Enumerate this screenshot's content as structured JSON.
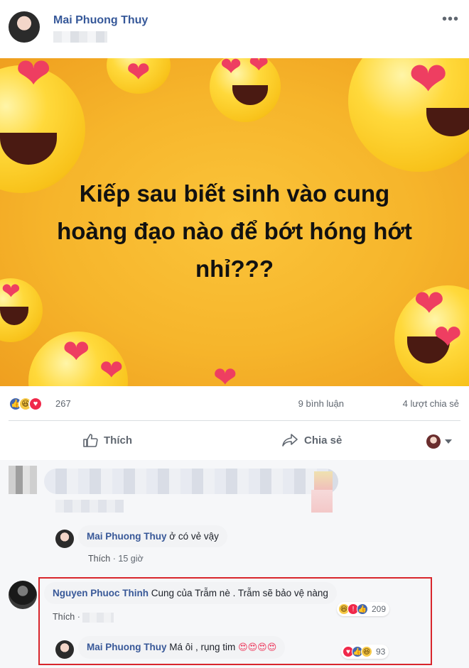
{
  "post": {
    "author": "Mai Phuong Thuy",
    "more_icon": "more-dots-icon",
    "image_text": "Kiếp sau biết sinh vào cung\nhoàng đạo nào để bớt hóng hớt\nnhỉ???"
  },
  "stats": {
    "reaction_icons": [
      "like-icon",
      "haha-icon",
      "love-icon"
    ],
    "reaction_count": "267",
    "comments": "9 bình luận",
    "shares": "4 lượt chia sẻ"
  },
  "actions": {
    "like_label": "Thích",
    "share_label": "Chia sẻ"
  },
  "comments": [
    {
      "author": "Mai Phuong Thuy",
      "text": "ở có vẻ vậy",
      "like_label": "Thích",
      "time": "15 giờ"
    },
    {
      "author": "Nguyen Phuoc Thinh",
      "text": "Cung của Trẫm nè . Trẫm sẽ bảo vệ nàng",
      "like_label": "Thích",
      "reaction_count": "209",
      "reply": {
        "author": "Mai Phuong Thuy",
        "text": "Má ôi , rụng tim",
        "emojis": "😍😍😍😍",
        "reaction_count": "93"
      }
    }
  ],
  "colors": {
    "name_blue": "#365899",
    "highlight_red": "#d8262c",
    "image_yellow": "#f6b52b"
  }
}
